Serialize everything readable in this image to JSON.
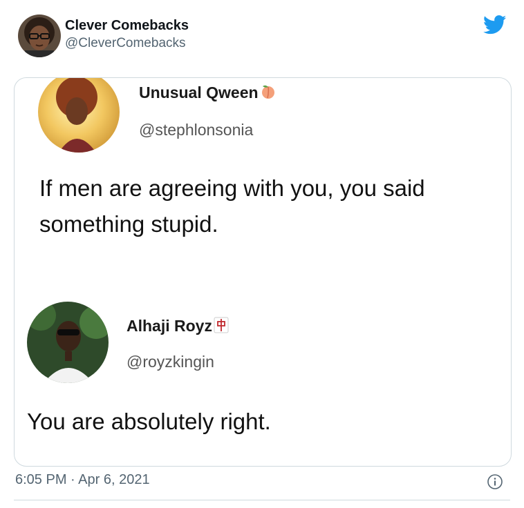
{
  "tweet": {
    "author": {
      "name": "Clever Comebacks",
      "handle": "@CleverComebacks",
      "avatar": "profile-photo"
    },
    "timestamp": "6:05 PM · Apr 6, 2021",
    "icons": {
      "brand": "twitter-bird-icon",
      "info": "info-icon"
    },
    "colors": {
      "twitter_blue": "#1d9bf0",
      "handle_gray": "#536471",
      "border": "#cfd9de"
    }
  },
  "embedded_tweets": [
    {
      "name": "Unusual Qween",
      "emoji": "peach-emoji",
      "handle": "@stephlonsonia",
      "text_line1": "If men are agreeing with you, you said",
      "text_line2": "something stupid."
    },
    {
      "name": "Alhaji Royz",
      "emoji": "mahjong-red-dragon-emoji",
      "handle": "@royzkingin",
      "text": "You are absolutely right."
    }
  ]
}
